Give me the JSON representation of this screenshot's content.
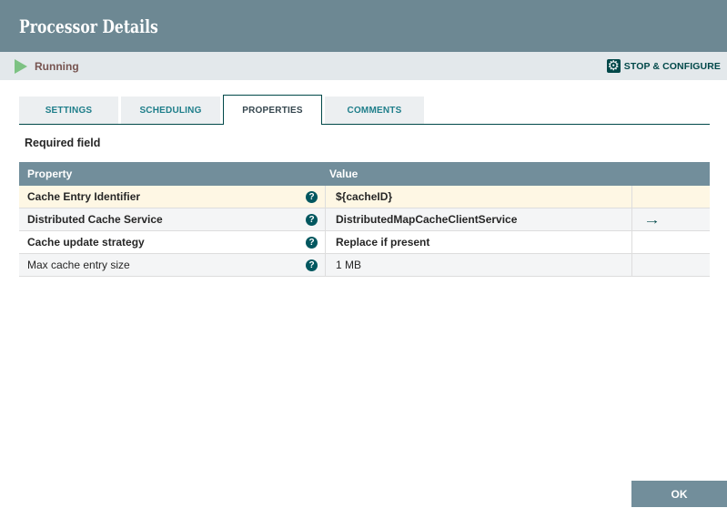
{
  "dialog": {
    "title": "Processor Details"
  },
  "status_bar": {
    "state": "Running",
    "action": "STOP & CONFIGURE"
  },
  "tabs": [
    {
      "label": "SETTINGS",
      "active": false
    },
    {
      "label": "SCHEDULING",
      "active": false
    },
    {
      "label": "PROPERTIES",
      "active": true
    },
    {
      "label": "COMMENTS",
      "active": false
    }
  ],
  "properties_panel": {
    "required_note": "Required field",
    "table": {
      "header": {
        "property": "Property",
        "value": "Value"
      },
      "rows": [
        {
          "property": "Cache Entry Identifier",
          "value": "${cacheID}",
          "required": true,
          "highlighted": true,
          "has_goto": false
        },
        {
          "property": "Distributed Cache Service",
          "value": "DistributedMapCacheClientService",
          "required": true,
          "highlighted": false,
          "has_goto": true
        },
        {
          "property": "Cache update strategy",
          "value": "Replace if present",
          "required": true,
          "highlighted": false,
          "has_goto": false
        },
        {
          "property": "Max cache entry size",
          "value": "1 MB",
          "required": false,
          "highlighted": false,
          "has_goto": false
        }
      ]
    }
  },
  "icons": {
    "help_glyph": "?",
    "goto_glyph": "→",
    "gear_glyph": "⚙"
  },
  "footer": {
    "ok": "OK"
  },
  "colors": {
    "header_bg": "#6d8893",
    "status_bar_bg": "#e3e8eb",
    "accent_teal": "#004849",
    "running_green": "#7dc283",
    "table_header_bg": "#728e9b",
    "highlight_row": "#fef7e4",
    "ok_button_bg": "#728e9b"
  }
}
